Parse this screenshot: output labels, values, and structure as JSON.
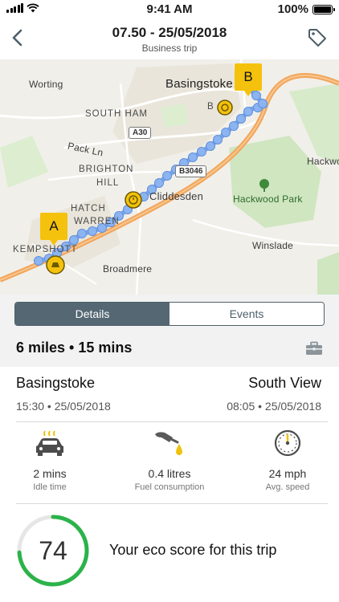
{
  "status_bar": {
    "time": "9:41 AM",
    "battery": "100%"
  },
  "nav": {
    "title": "07.50 - 25/05/2018",
    "subtitle": "Business trip"
  },
  "map": {
    "labels": {
      "worting": "Worting",
      "basingstoke": "Basingstoke",
      "south_ham": "SOUTH HAM",
      "a30": "A30",
      "pack_ln": "Pack Ln",
      "brighton": "BRIGHTON",
      "hill": "HILL",
      "b3046": "B3046",
      "cliddesden": "Cliddesden",
      "hatch": "HATCH",
      "warren": "WARREN",
      "kempshott": "KEMPSHOTT",
      "broadmere": "Broadmere",
      "hackwood_park": "Hackwood Park",
      "hackwood": "Hackwo",
      "winslade": "Winslade",
      "b_partial": "B"
    },
    "pin_start": "A",
    "pin_end": "B",
    "route_color": "#7fa9ec",
    "pin_color": "#f4c20d"
  },
  "tabs": [
    {
      "label": "Details",
      "active": true
    },
    {
      "label": "Events",
      "active": false
    }
  ],
  "summary": "6 miles • 15 mins",
  "route": {
    "from_place": "Basingstoke",
    "from_time": "15:30 • 25/05/2018",
    "to_place": "South View",
    "to_time": "08:05 • 25/05/2018"
  },
  "stats": [
    {
      "icon": "idle-car-icon",
      "value": "2 mins",
      "label": "Idle time"
    },
    {
      "icon": "fuel-pump-icon",
      "value": "0.4 litres",
      "label": "Fuel consumption"
    },
    {
      "icon": "speedometer-icon",
      "value": "24 mph",
      "label": "Avg. speed"
    }
  ],
  "eco": {
    "score": "74",
    "score_fraction": 0.74,
    "text": "Your eco score for this trip",
    "ring_color": "#2bb34a"
  },
  "colors": {
    "accent": "#546773",
    "fuel": "#f0c20c"
  }
}
